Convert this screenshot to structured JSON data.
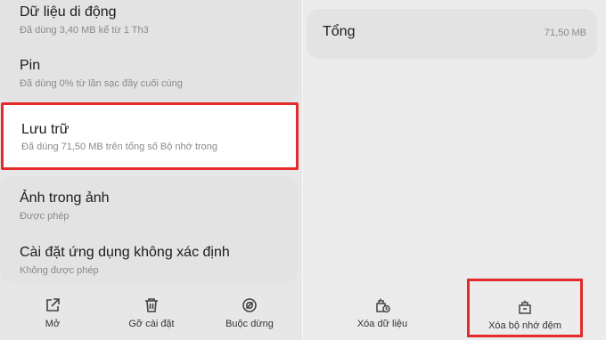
{
  "left": {
    "items": [
      {
        "title": "Dữ liệu di động",
        "subtitle": "Đã dùng 3,40 MB kể từ 1 Th3"
      },
      {
        "title": "Pin",
        "subtitle": "Đã dùng 0% từ lần sạc đầy cuối cùng"
      },
      {
        "title": "Lưu trữ",
        "subtitle": "Đã dùng 71,50 MB trên tổng số Bộ nhớ trong"
      },
      {
        "title": "Ảnh trong ảnh",
        "subtitle": "Được phép"
      },
      {
        "title": "Cài đặt ứng dụng không xác định",
        "subtitle": "Không được phép"
      }
    ],
    "actions": [
      {
        "label": "Mở",
        "icon": "open-external-icon"
      },
      {
        "label": "Gỡ cài đặt",
        "icon": "trash-icon"
      },
      {
        "label": "Buộc dừng",
        "icon": "force-stop-icon"
      }
    ]
  },
  "right": {
    "total": {
      "label": "Tổng",
      "value": "71,50 MB"
    },
    "actions": [
      {
        "label": "Xóa dữ liệu",
        "icon": "clear-data-icon"
      },
      {
        "label": "Xóa bộ nhớ đệm",
        "icon": "clear-cache-icon"
      }
    ]
  },
  "colors": {
    "highlight": "#e32b2b",
    "background": "#e7e7e7",
    "card": "#e3e3e3"
  }
}
